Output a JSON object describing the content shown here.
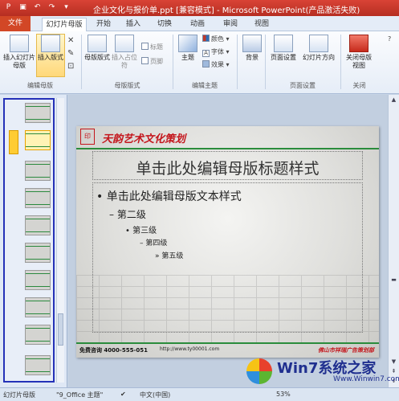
{
  "window": {
    "title": "企业文化与报价单.ppt [兼容模式] - Microsoft PowerPoint(产品激活失败)"
  },
  "quick_access": [
    "save-icon",
    "undo-icon",
    "redo-icon",
    "dropdown-icon"
  ],
  "tabs": [
    {
      "label": "文件"
    },
    {
      "label": "幻灯片母版"
    },
    {
      "label": "开始"
    },
    {
      "label": "插入"
    },
    {
      "label": "切换"
    },
    {
      "label": "动画"
    },
    {
      "label": "审阅"
    },
    {
      "label": "视图"
    }
  ],
  "ribbon": {
    "edit_master": {
      "insert_master": "插入幻灯片母版",
      "insert_layout": "插入版式",
      "group": "编辑母版"
    },
    "master_layout": {
      "master_layout": "母版版式",
      "insert_placeholder": "插入占位符",
      "title": "标题",
      "footer": "页脚",
      "group": "母版版式"
    },
    "edit_theme": {
      "theme": "主题",
      "colors": "颜色",
      "fonts": "字体",
      "effects": "效果",
      "group": "编辑主题"
    },
    "background": {
      "background": "背景"
    },
    "page_setup": {
      "page_setup": "页面设置",
      "orientation": "幻灯片方向",
      "group": "页面设置"
    },
    "close": {
      "close": "关闭母版视图",
      "group": "关闭"
    }
  },
  "slide": {
    "logo_text": "天韵艺术文化策划",
    "title": "单击此处编辑母版标题样式",
    "levels": [
      "单击此处编辑母版文本样式",
      "第二级",
      "第三级",
      "第四级",
      "第五级"
    ],
    "bullets": [
      "•",
      "–",
      "•",
      "–",
      "»"
    ],
    "footer_left": "免费咨询 4000-555-051",
    "footer_mid": "http://www.ty00001.com",
    "footer_right": "佛山市祥瑞广告策划部"
  },
  "statusbar": {
    "view": "幻灯片母版",
    "theme": "\"9_Office 主题\"",
    "language": "中文(中国)",
    "zoom": "53%"
  },
  "watermark": {
    "text": "Win7系统之家",
    "url": "Www.Winwin7.com"
  },
  "colors": {
    "title_bar": "#c9392b",
    "file_tab": "#d24726",
    "thumb_frame": "#2431b8",
    "slide_accent": "#2a8c3c",
    "logo_red": "#c4161c"
  }
}
